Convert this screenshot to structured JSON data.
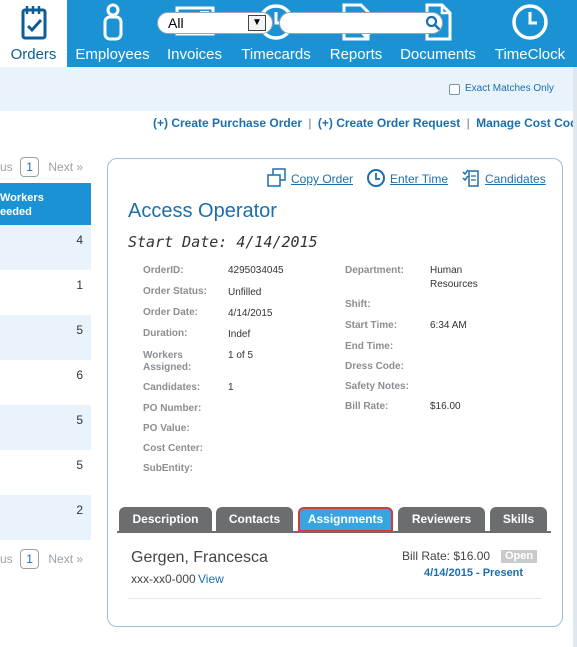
{
  "nav": {
    "items": [
      {
        "label": "Orders",
        "icon": "clipboard-calendar-icon"
      },
      {
        "label": "Employees",
        "icon": "person-icon"
      },
      {
        "label": "Invoices",
        "icon": "invoice-icon"
      },
      {
        "label": "Timecards",
        "icon": "clock-icon"
      },
      {
        "label": "Reports",
        "icon": "report-download-icon"
      },
      {
        "label": "Documents",
        "icon": "document-icon"
      },
      {
        "label": "TimeClock",
        "icon": "clock-icon"
      }
    ],
    "active": "Orders",
    "colors": {
      "bar": "#1b92d3",
      "active_bg": "#ffffff",
      "active_text": "#0d5e96"
    }
  },
  "search": {
    "filter_value": "All",
    "query": "",
    "exact_label": "Exact Matches Only",
    "exact_checked": false
  },
  "actions": {
    "create_po": "(+) Create Purchase Order",
    "sep1": "|",
    "create_request": "(+) Create Order Request",
    "sep2": "|",
    "manage_cost": "Manage Cost Codes"
  },
  "list": {
    "pager_prev": "us",
    "pager_page": "1",
    "pager_next": "Next »",
    "header_line1": "Workers",
    "header_line2": "leeded",
    "rows": [
      "4",
      "1",
      "5",
      "6",
      "5",
      "5",
      "2"
    ]
  },
  "order": {
    "copy_label": "Copy Order",
    "enter_time_label": "Enter Time",
    "candidates_label": "Candidates",
    "title": "Access Operator",
    "start_date": "Start Date: 4/14/2015",
    "left_fields": {
      "order_id_label": "OrderID:",
      "order_id": "4295034045",
      "status_label": "Order Status:",
      "status": "Unfilled",
      "date_label": "Order Date:",
      "date": "4/14/2015",
      "duration_label": "Duration:",
      "duration": "Indef",
      "workers_label_1": "Workers",
      "workers_label_2": "Assigned:",
      "workers": "1 of 5",
      "candidates_label": "Candidates:",
      "candidates": "1",
      "po_number_label": "PO Number:",
      "po_value_label": "PO Value:",
      "cost_center_label": "Cost Center:",
      "subentity_label": "SubEntity:"
    },
    "right_fields": {
      "department_label": "Department:",
      "department_1": "Human",
      "department_2": "Resources",
      "shift_label": "Shift:",
      "start_time_label": "Start Time:",
      "start_time": "6:34 AM",
      "end_time_label": "End Time:",
      "dress_code_label": "Dress Code:",
      "safety_label": "Safety Notes:",
      "bill_rate_label": "Bill Rate:",
      "bill_rate": "$16.00"
    },
    "tabs": [
      "Description",
      "Contacts",
      "Assignments",
      "Reviewers",
      "Skills"
    ],
    "active_tab": "Assignments",
    "assignment": {
      "name": "Gergen, Francesca",
      "ssn": "xxx-xx0-000",
      "view": "View",
      "bill_rate": "Bill Rate: $16.00",
      "status": "Open",
      "range": "4/14/2015 - Present"
    }
  }
}
